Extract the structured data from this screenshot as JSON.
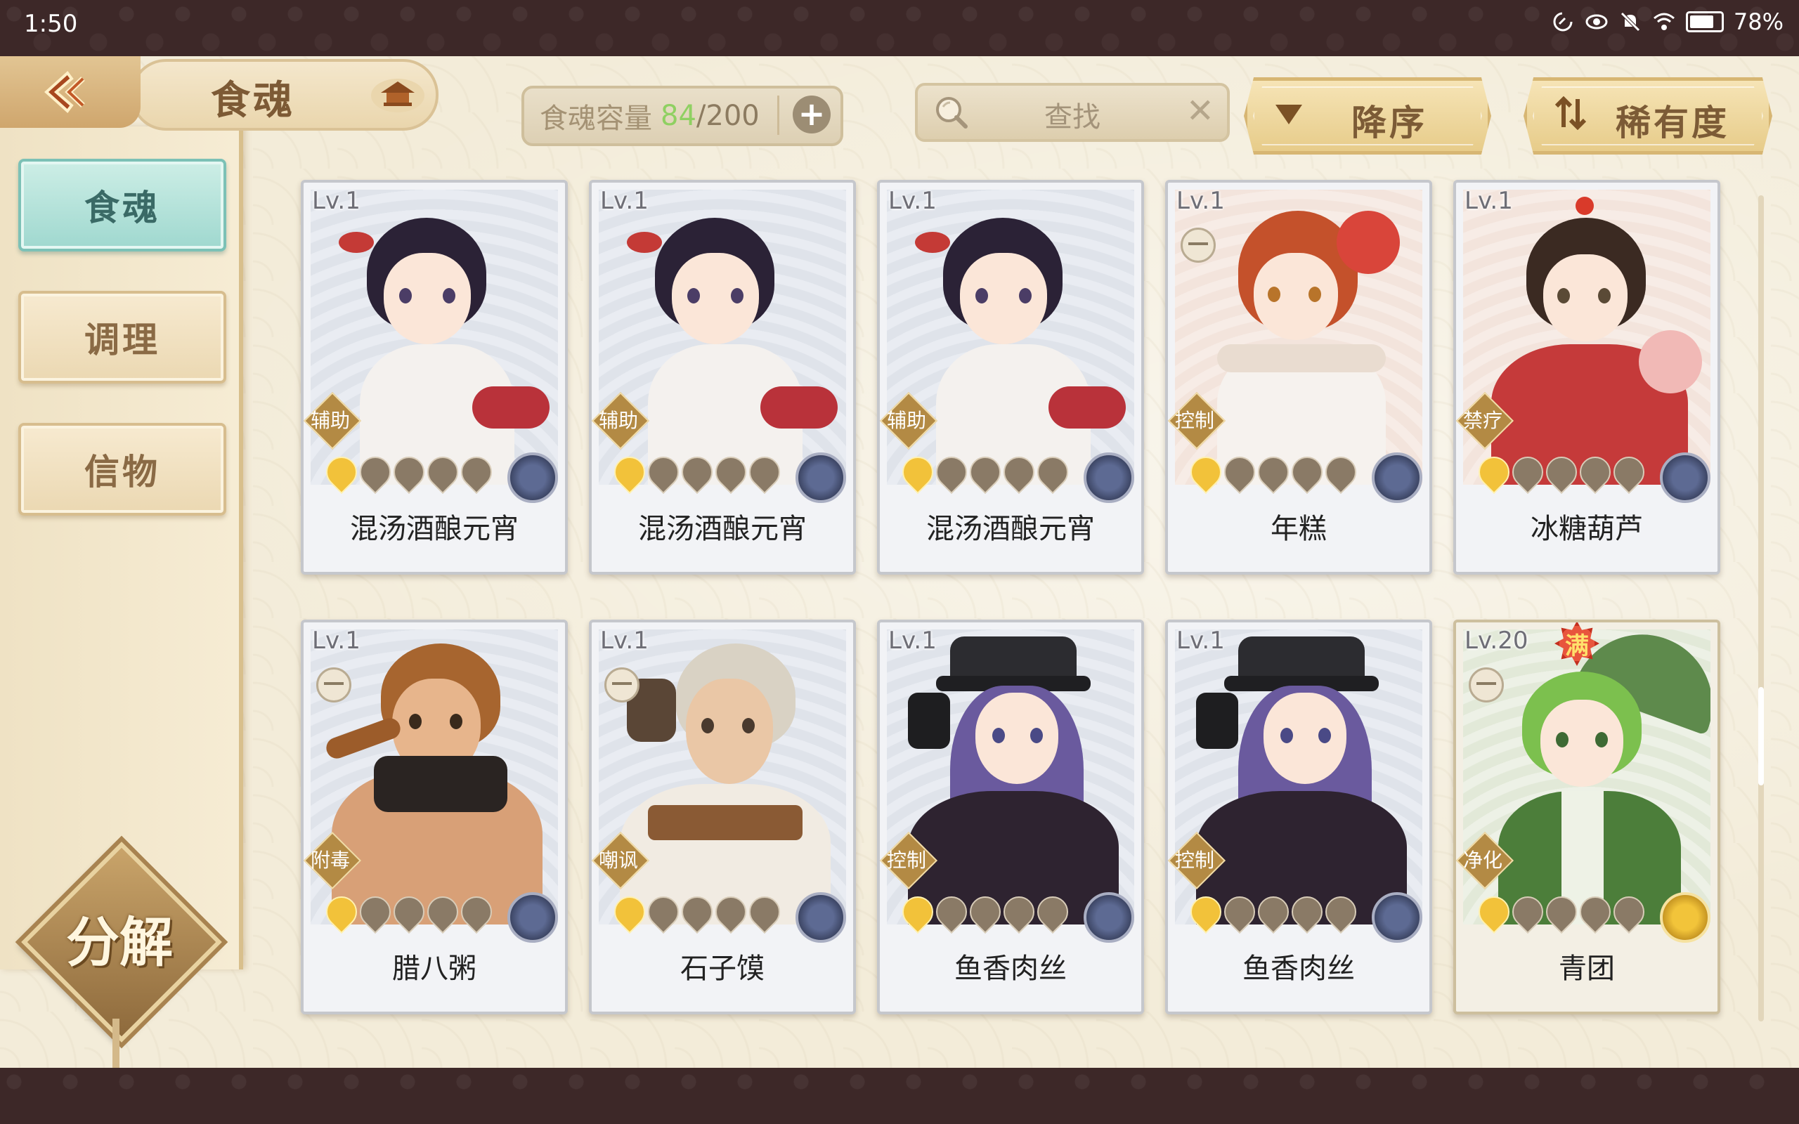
{
  "status_bar": {
    "time": "1:50",
    "battery": "78%",
    "icons": [
      "data-saver-icon",
      "eye-comfort-icon",
      "mute-icon",
      "wifi-icon",
      "battery-icon"
    ]
  },
  "header": {
    "title": "食魂",
    "capacity_label": "食魂容量",
    "capacity_used": "84",
    "capacity_total": "/200",
    "search_placeholder": "查找",
    "sort_order_label": "降序",
    "sort_key_label": "稀有度"
  },
  "sidebar": {
    "tabs": [
      {
        "label": "食魂",
        "active": true
      },
      {
        "label": "调理",
        "active": false
      },
      {
        "label": "信物",
        "active": false
      }
    ],
    "decompose_label": "分解"
  },
  "cards": [
    {
      "level": "Lv.1",
      "role": "辅助",
      "name": "混汤酒酿元宵",
      "stars": 1,
      "element": "blue"
    },
    {
      "level": "Lv.1",
      "role": "辅助",
      "name": "混汤酒酿元宵",
      "stars": 1,
      "element": "blue"
    },
    {
      "level": "Lv.1",
      "role": "辅助",
      "name": "混汤酒酿元宵",
      "stars": 1,
      "element": "blue"
    },
    {
      "level": "Lv.1",
      "role": "控制",
      "name": "年糕",
      "stars": 1,
      "element": "blue"
    },
    {
      "level": "Lv.1",
      "role": "禁疗",
      "name": "冰糖葫芦",
      "stars": 1,
      "element": "blue"
    },
    {
      "level": "Lv.1",
      "role": "附毒",
      "name": "腊八粥",
      "stars": 1,
      "element": "blue"
    },
    {
      "level": "Lv.1",
      "role": "嘲讽",
      "name": "石子馍",
      "stars": 1,
      "element": "blue"
    },
    {
      "level": "Lv.1",
      "role": "控制",
      "name": "鱼香肉丝",
      "stars": 1,
      "element": "blue"
    },
    {
      "level": "Lv.1",
      "role": "控制",
      "name": "鱼香肉丝",
      "stars": 1,
      "element": "blue"
    },
    {
      "level": "Lv.20",
      "role": "净化",
      "name": "青团",
      "stars": 1,
      "element": "gold",
      "max_badge": "满"
    }
  ],
  "colors": {
    "accent_gold": "#e7cc8a",
    "active_tab": "#9fd8cf",
    "capacity_used": "#8fd062"
  }
}
